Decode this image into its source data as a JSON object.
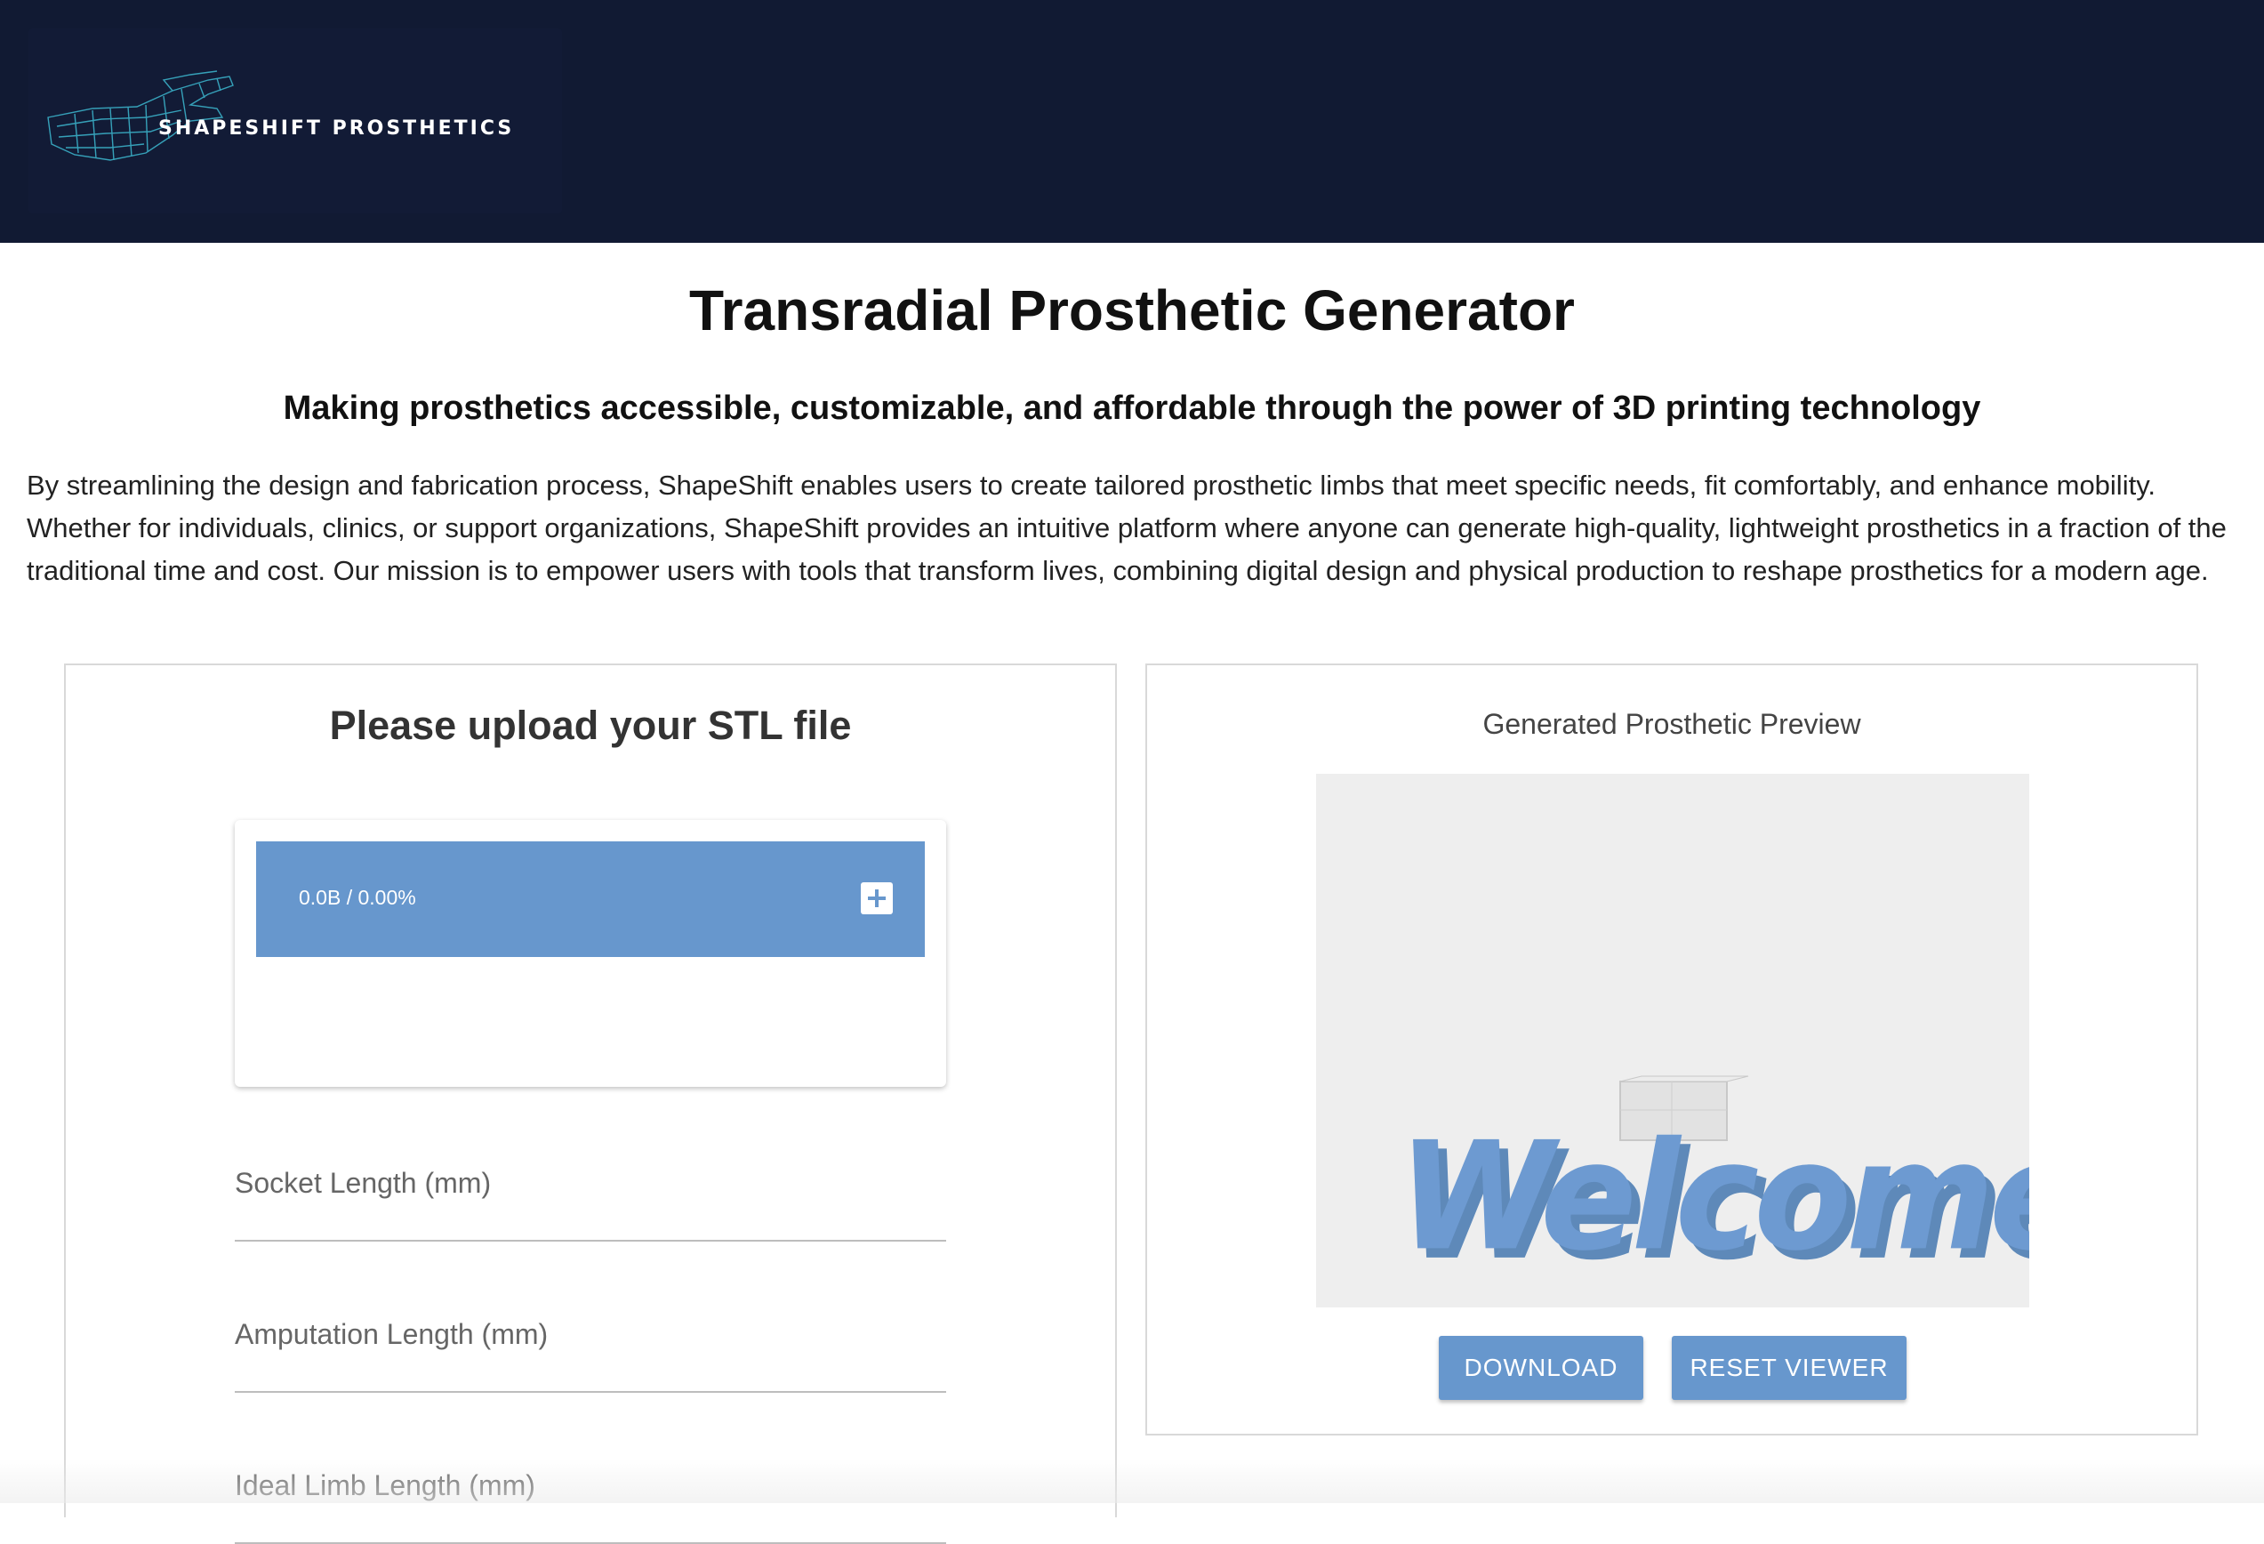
{
  "header": {
    "logo_text": "SHAPESHIFT PROSTHETICS"
  },
  "page": {
    "title": "Transradial Prosthetic Generator",
    "subtitle": "Making prosthetics accessible, customizable, and affordable through the power of 3D printing technology",
    "description": "By streamlining the design and fabrication process, ShapeShift enables users to create tailored prosthetic limbs that meet specific needs, fit comfortably, and enhance mobility. Whether for individuals, clinics, or support organizations, ShapeShift provides an intuitive platform where anyone can generate high-quality, lightweight prosthetics in a fraction of the traditional time and cost. Our mission is to empower users with tools that transform lives, combining digital design and physical production to reshape prosthetics for a modern age."
  },
  "upload": {
    "title": "Please upload your STL file",
    "progress_text": "0.0B / 0.00%",
    "add_icon": "plus-icon",
    "fields": [
      {
        "label": "Socket Length (mm)",
        "value": ""
      },
      {
        "label": "Amputation Length (mm)",
        "value": ""
      },
      {
        "label": "Ideal Limb Length (mm)",
        "value": ""
      }
    ]
  },
  "preview": {
    "title": "Generated Prosthetic Preview",
    "viewer_text": "Welcome!",
    "download_label": "DOWNLOAD",
    "reset_label": "RESET VIEWER"
  },
  "colors": {
    "header_bg": "#111a33",
    "accent": "#6797cd",
    "viewer_bg": "#eeeeee"
  }
}
